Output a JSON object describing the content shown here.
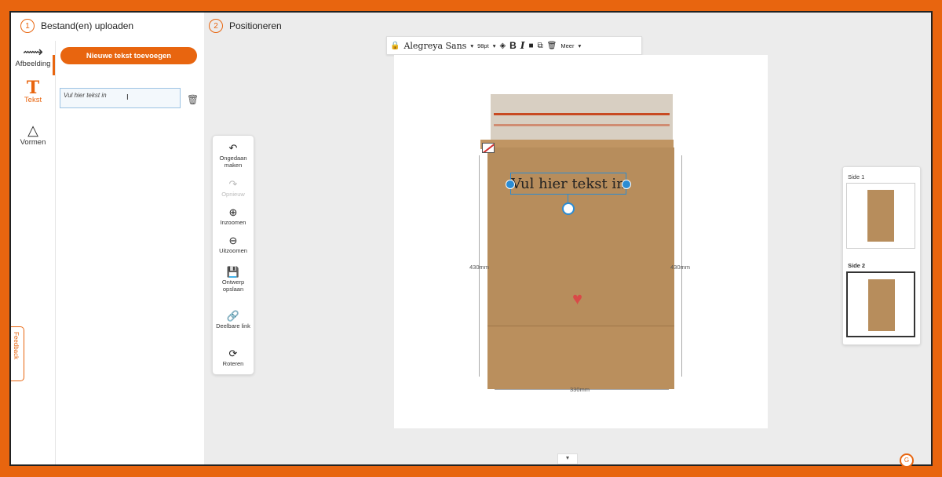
{
  "steps": [
    {
      "num": "1",
      "label": "Bestand(en) uploaden"
    },
    {
      "num": "2",
      "label": "Positioneren"
    }
  ],
  "rail": {
    "image": {
      "label": "Afbeelding",
      "icon": "image-icon"
    },
    "text": {
      "label": "Tekst",
      "icon": "text-T-icon"
    },
    "shapes": {
      "label": "Vormen",
      "icon": "shapes-icon"
    }
  },
  "add_text_button": "Nieuwe tekst toevoegen",
  "text_entry_value": "Vul hier tekst in",
  "feedback_label": "Feedback",
  "toolbar": {
    "font": "Alegreya Sans",
    "size": "98pt",
    "more": "Meer"
  },
  "side_tools": {
    "undo": "Ongedaan maken",
    "redo": "Opnieuw",
    "zoom_in": "Inzoomen",
    "zoom_out": "Uitzoomen",
    "save": "Ontwerp opslaan",
    "share": "Deelbare link",
    "rotate": "Roteren"
  },
  "canvas": {
    "text_box": "Vul hier tekst in",
    "height_label_left": "430mm",
    "height_label_right": "430mm",
    "width_label": "330mm"
  },
  "sides": [
    {
      "label": "Side 1",
      "selected": false
    },
    {
      "label": "Side 2",
      "selected": true
    }
  ],
  "colors": {
    "accent": "#e8650f",
    "selection": "#2b8cd3",
    "kraft": "#b78d5c"
  }
}
